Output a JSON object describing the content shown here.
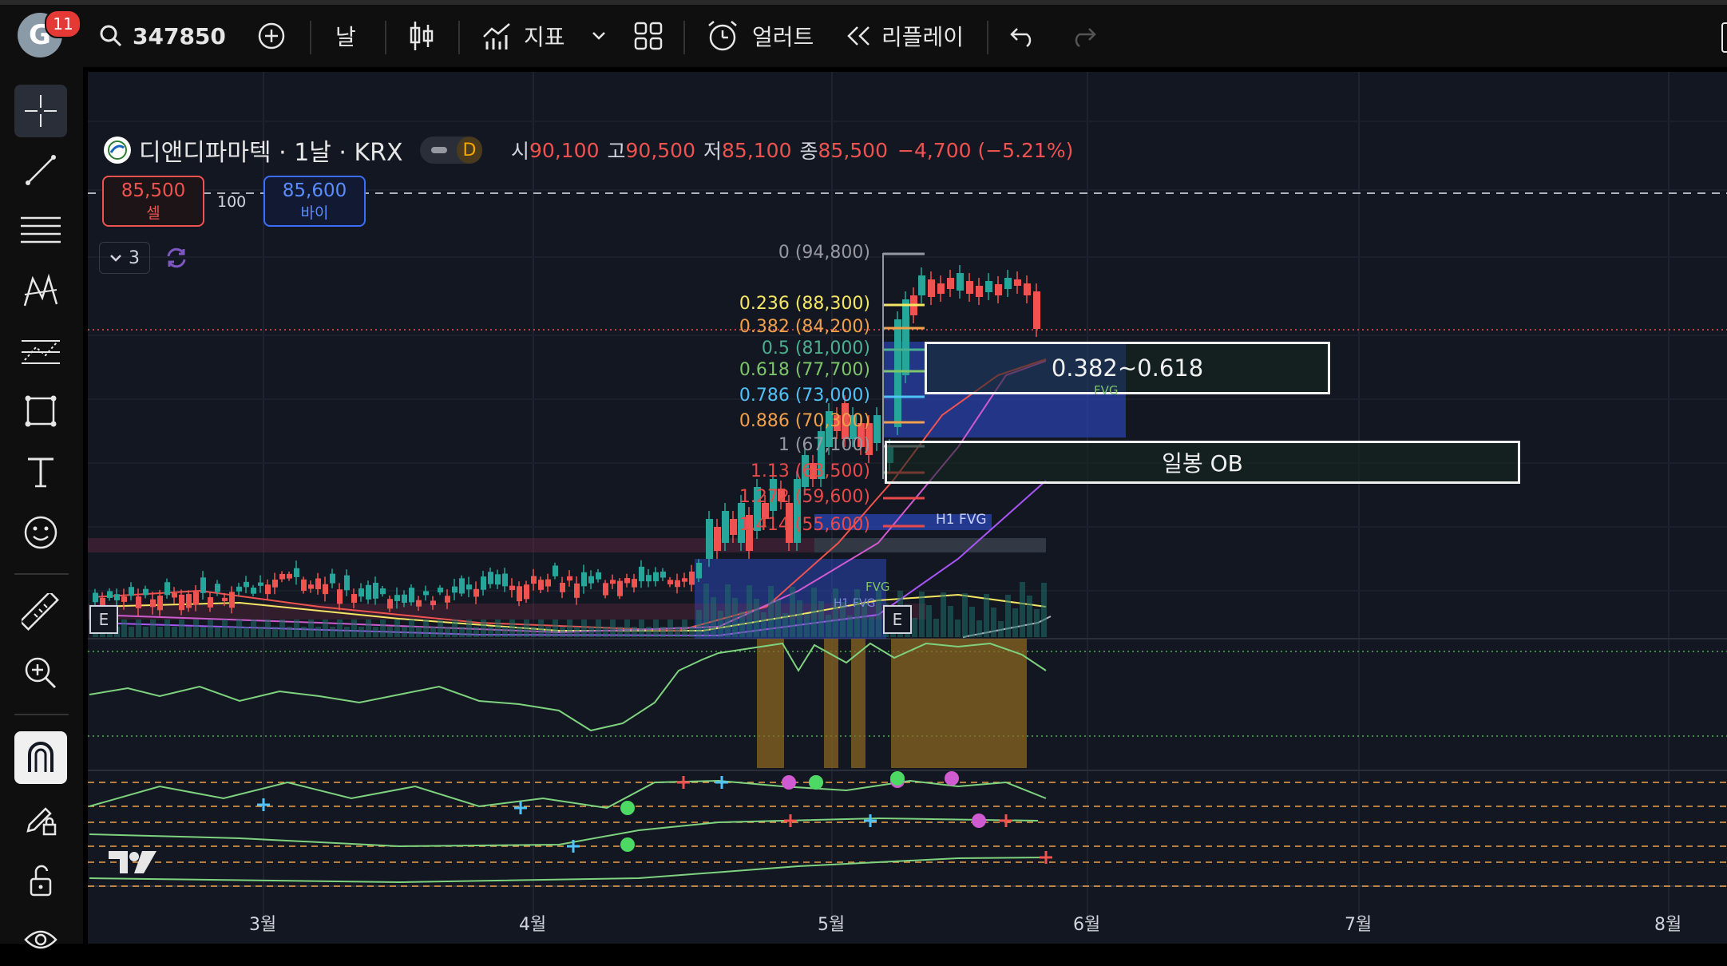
{
  "toolbar": {
    "badge_count": "11",
    "avatar_letter": "G",
    "symbol": "347850",
    "interval": "날",
    "indicators_label": "지표",
    "alerts_label": "얼러트",
    "replay_label": "리플레이"
  },
  "legend": {
    "name": "디앤디파마텍 · 1날 · KRX",
    "d_badge": "D",
    "open_label": "시",
    "open": "90,100",
    "high_label": "고",
    "high": "90,500",
    "low_label": "저",
    "low": "85,100",
    "close_label": "종",
    "close": "85,500",
    "change": "−4,700 (−5.21%)",
    "sell_price": "85,500",
    "sell_label": "셀",
    "quantity": "100",
    "buy_price": "85,600",
    "buy_label": "바이",
    "collapse_count": "3"
  },
  "fib": [
    {
      "text": "0 (94,800)",
      "color": "#9598a1"
    },
    {
      "text": "0.236 (88,300)",
      "color": "#f5e663"
    },
    {
      "text": "0.382 (84,200)",
      "color": "#f0a04a"
    },
    {
      "text": "0.5 (81,000)",
      "color": "#4caf8f"
    },
    {
      "text": "0.618 (77,700)",
      "color": "#7ec46b"
    },
    {
      "text": "0.786 (73,000)",
      "color": "#4fc3f7"
    },
    {
      "text": "0.886 (70,300)",
      "color": "#f0a04a"
    },
    {
      "text": "1 (67,100)",
      "color": "#9598a1"
    },
    {
      "text": "1.13 (63,500)",
      "color": "#e84a4a"
    },
    {
      "text": "1.272 (59,600)",
      "color": "#e84a4a"
    },
    {
      "text": "1.414 (55,600)",
      "color": "#e84a4a"
    }
  ],
  "annotations": {
    "fib_zone": "0.382~0.618",
    "ob_label": "일봉 OB",
    "h1_fvg": "H1 FVG",
    "fvg": "FVG",
    "fvg_small": "FVG",
    "h1_fvg_small": "H1 FVG",
    "earnings": "E"
  },
  "months": [
    "3월",
    "4월",
    "5월",
    "6월",
    "7월",
    "8월"
  ],
  "colors": {
    "up": "#26a69a",
    "down": "#ef5350",
    "background": "#131722"
  }
}
